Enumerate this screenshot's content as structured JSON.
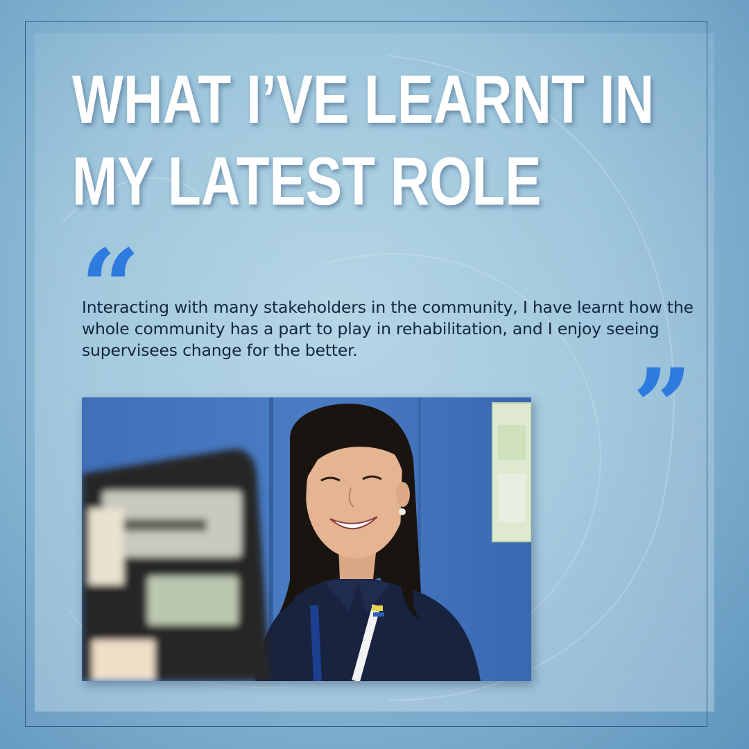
{
  "title": {
    "line1": "WHAT I’VE LEARNT IN",
    "line2": "MY LATEST ROLE"
  },
  "quote": {
    "open_mark": "“",
    "close_mark": "”",
    "text": "Interacting with many stakeholders in the community, I have learnt how the whole community has a part to play in rehabilitation, and I enjoy seeing supervisees change for the better."
  },
  "colors": {
    "accent_blue": "#2e7be0",
    "title_white": "#ffffff",
    "quote_text": "#12253f",
    "frame_line": "#2e5a8c"
  },
  "photo": {
    "subject": "smiling woman in navy uniform with lanyard, blurred laptop in foreground"
  }
}
